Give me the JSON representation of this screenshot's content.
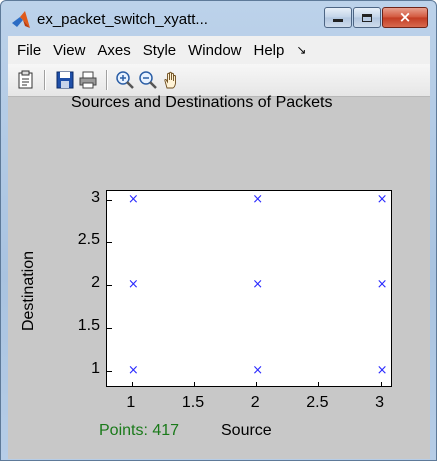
{
  "window": {
    "title": "ex_packet_switch_xyatt...",
    "controls": {
      "minimize": "minimize",
      "maximize": "maximize",
      "close": "×"
    }
  },
  "menubar": {
    "items": [
      "File",
      "View",
      "Axes",
      "Style",
      "Window",
      "Help"
    ],
    "more": "↘"
  },
  "toolbar": {
    "buttons": [
      "clipboard-icon",
      "save-icon",
      "print-icon",
      "zoom-in-icon",
      "zoom-out-icon",
      "pan-hand-icon"
    ]
  },
  "status": {
    "points_label": "Points: 417"
  },
  "chart_data": {
    "type": "scatter",
    "title": "Sources and Destinations of Packets",
    "xlabel": "Source",
    "ylabel": "Destination",
    "xlim": [
      0.8,
      3.1
    ],
    "ylim": [
      0.8,
      3.1
    ],
    "xticks": [
      "1",
      "1.5",
      "2",
      "2.5",
      "3"
    ],
    "yticks": [
      "1",
      "1.5",
      "2",
      "2.5",
      "3"
    ],
    "marker": "x",
    "marker_color": "#2a2aff",
    "points": [
      {
        "x": 1,
        "y": 1
      },
      {
        "x": 2,
        "y": 1
      },
      {
        "x": 3,
        "y": 1
      },
      {
        "x": 1,
        "y": 2
      },
      {
        "x": 2,
        "y": 2
      },
      {
        "x": 3,
        "y": 2
      },
      {
        "x": 1,
        "y": 3
      },
      {
        "x": 2,
        "y": 3
      },
      {
        "x": 3,
        "y": 3
      }
    ],
    "grid": false
  }
}
